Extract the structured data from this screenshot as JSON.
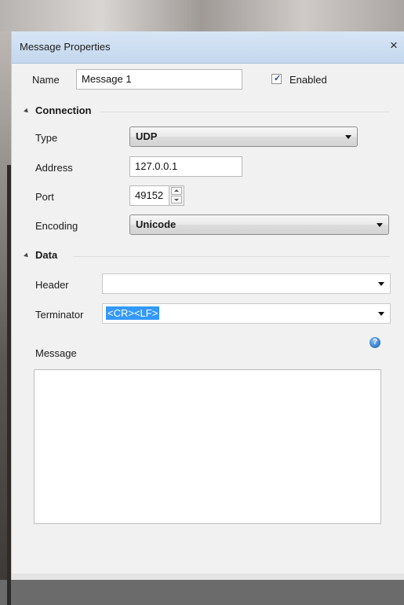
{
  "window": {
    "title": "Message Properties",
    "close_label": "×"
  },
  "name": {
    "label": "Name",
    "value": "Message 1"
  },
  "enabled": {
    "label": "Enabled",
    "checked": true,
    "check_glyph": "✓"
  },
  "connection": {
    "section_label": "Connection",
    "type": {
      "label": "Type",
      "value": "UDP"
    },
    "address": {
      "label": "Address",
      "value": "127.0.0.1"
    },
    "port": {
      "label": "Port",
      "value": "49152"
    },
    "encoding": {
      "label": "Encoding",
      "value": "Unicode"
    }
  },
  "data": {
    "section_label": "Data",
    "header": {
      "label": "Header",
      "value": ""
    },
    "terminator": {
      "label": "Terminator",
      "value": "<CR><LF>"
    },
    "message": {
      "label": "Message",
      "value": "",
      "help_glyph": "?"
    }
  }
}
